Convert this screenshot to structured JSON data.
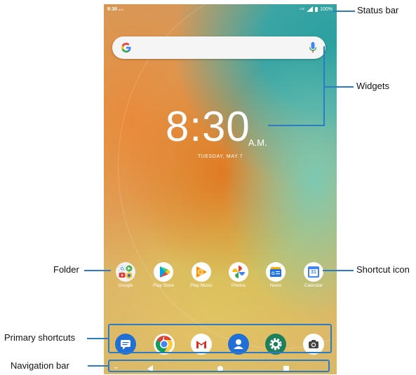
{
  "status_bar": {
    "time": "8:30",
    "time_suffix": "a.m.",
    "network": "LTE",
    "battery": "100%"
  },
  "widgets": {
    "clock_time": "8:30",
    "clock_ampm": "A.M.",
    "date": "TUESDAY, MAY 7"
  },
  "search": {
    "google_icon": "google-g-icon",
    "mic_icon": "microphone-icon"
  },
  "apps": [
    {
      "label": "Google",
      "icon": "google-folder-icon"
    },
    {
      "label": "Play Store",
      "icon": "play-store-icon"
    },
    {
      "label": "Play Music",
      "icon": "play-music-icon"
    },
    {
      "label": "Photos",
      "icon": "photos-icon"
    },
    {
      "label": "News",
      "icon": "news-icon"
    },
    {
      "label": "Calendar",
      "icon": "calendar-icon",
      "badge": "31"
    }
  ],
  "dock": [
    {
      "icon": "messages-icon",
      "color": "#1f6fd6"
    },
    {
      "icon": "chrome-icon",
      "color": "#ffffff"
    },
    {
      "icon": "gmail-icon",
      "color": "#ffffff"
    },
    {
      "icon": "contacts-icon",
      "color": "#1f6fd6"
    },
    {
      "icon": "settings-icon",
      "color": "#1e7f5c"
    },
    {
      "icon": "camera-icon",
      "color": "#ffffff"
    }
  ],
  "navigation": {
    "chevron": "⌄",
    "icons": [
      "chevron-down-icon",
      "back-icon",
      "home-icon",
      "recents-icon"
    ]
  },
  "callouts": {
    "status_bar": "Status bar",
    "widgets": "Widgets",
    "folder": "Folder",
    "shortcut_icon": "Shortcut icon",
    "primary_shortcuts": "Primary shortcuts",
    "navigation_bar": "Navigation bar"
  },
  "colors": {
    "callout_line": "#2b7cc4"
  }
}
